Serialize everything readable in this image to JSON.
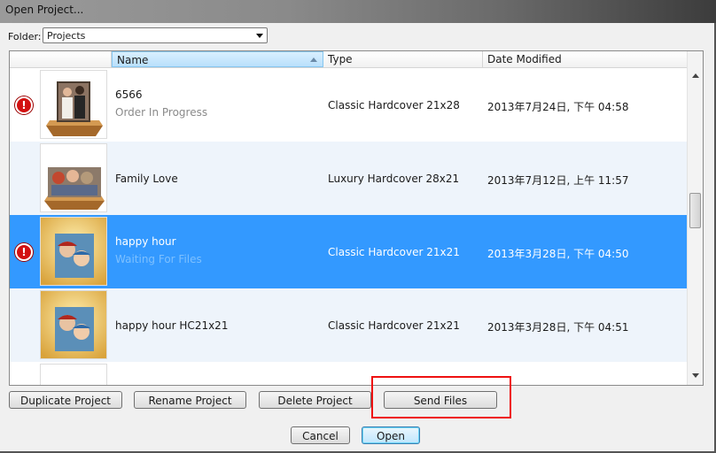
{
  "window": {
    "title": "Open Project..."
  },
  "folder": {
    "label": "Folder:",
    "selected": "Projects"
  },
  "columns": {
    "name": "Name",
    "type": "Type",
    "date": "Date Modified"
  },
  "rows": [
    {
      "name": "6566",
      "status": "Order In Progress",
      "type": "Classic Hardcover 21x28",
      "date": "2013年7月24日, 下午 04:58",
      "warning_glyph": "!"
    },
    {
      "name": "Family Love",
      "status": "",
      "type": "Luxury Hardcover 28x21",
      "date": "2013年7月12日, 上午 11:57"
    },
    {
      "name": "happy hour",
      "status": "Waiting For Files",
      "type": "Classic Hardcover 21x21",
      "date": "2013年3月28日, 下午 04:50",
      "warning_glyph": "!"
    },
    {
      "name": "happy hour HC21x21",
      "status": "",
      "type": "Classic Hardcover 21x21",
      "date": "2013年3月28日, 下午 04:51"
    }
  ],
  "actions": {
    "duplicate": "Duplicate Project",
    "rename": "Rename Project",
    "delete": "Delete Project",
    "send": "Send Files"
  },
  "dialog": {
    "cancel": "Cancel",
    "open": "Open"
  },
  "colors": {
    "selection": "#3399ff",
    "highlight_box": "#ee1111",
    "warning": "#d21010"
  }
}
